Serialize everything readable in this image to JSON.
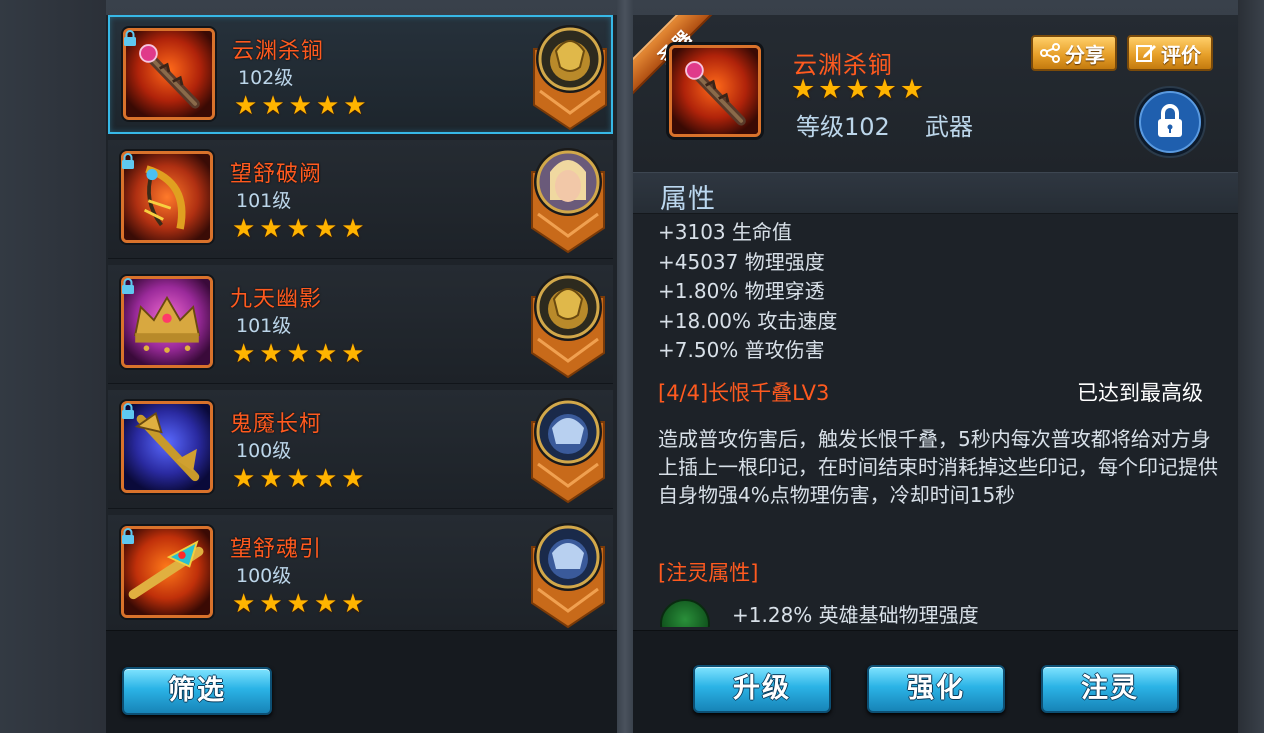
{
  "items": [
    {
      "name": "云渊杀锏",
      "level": "102级",
      "stars": 5,
      "selected": true
    },
    {
      "name": "望舒破阙",
      "level": "101级",
      "stars": 5
    },
    {
      "name": "九天幽影",
      "level": "101级",
      "stars": 5
    },
    {
      "name": "鬼魇长柯",
      "level": "100级",
      "stars": 5
    },
    {
      "name": "望舒魂引",
      "level": "100级",
      "stars": 5
    }
  ],
  "star_glyph": "★",
  "filter_label": "筛选",
  "detail": {
    "badge": "圣器",
    "name": "云渊杀锏",
    "stars": 5,
    "level": "等级102",
    "type": "武器",
    "share_label": "分享",
    "review_label": "评价",
    "section_title": "属性",
    "attributes": [
      "+3103 生命值",
      "+45037 物理强度",
      "+1.80% 物理穿透",
      "+18.00% 攻击速度",
      "+7.50% 普攻伤害"
    ],
    "skill_title": "[4/4]长恨千叠LV3",
    "skill_status": "已达到最高级",
    "skill_desc": "造成普攻伤害后，触发长恨千叠，5秒内每次普攻都将给对方身上插上一根印记，在时间结束时消耗掉这些印记，每个印记提供自身物强4%点物理伤害，冷却时间15秒",
    "spirit_title": "[注灵属性]",
    "spirit_attr": "+1.28% 英雄基础物理强度"
  },
  "actions": {
    "upgrade": "升级",
    "enhance": "强化",
    "infuse": "注灵"
  },
  "colors": {
    "name_orange": "#ff5a1f",
    "star_gold": "#ffb400",
    "selection_blue": "#37b8e6",
    "button_blue": "#2bb3e6"
  }
}
